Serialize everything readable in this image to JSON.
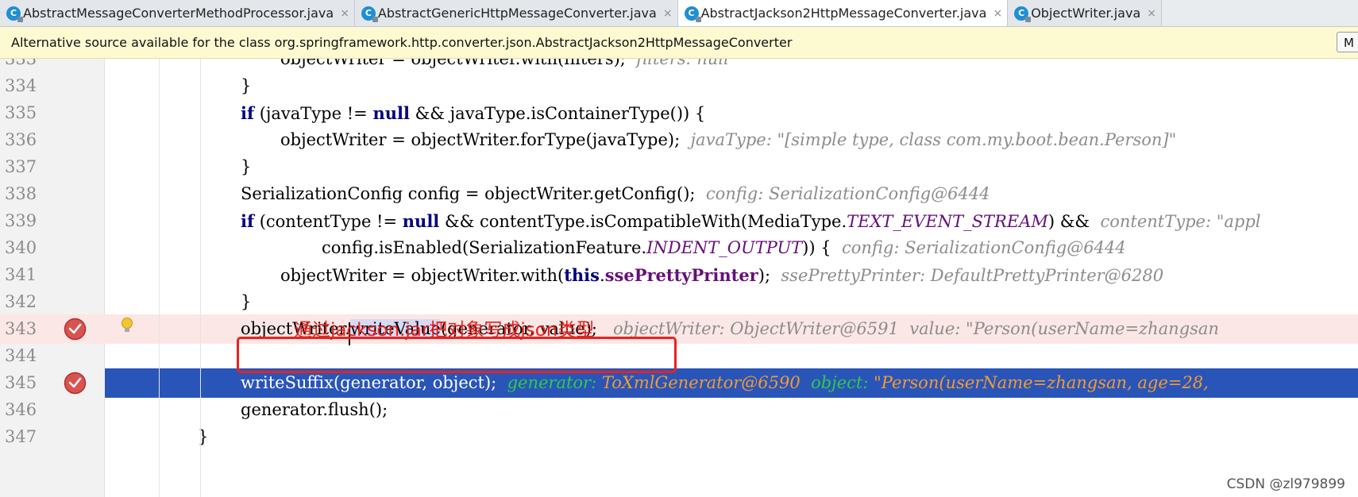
{
  "tabs": [
    {
      "label": "AbstractMessageConverterMethodProcessor.java",
      "active": false
    },
    {
      "label": "AbstractGenericHttpMessageConverter.java",
      "active": false
    },
    {
      "label": "AbstractJackson2HttpMessageConverter.java",
      "active": true
    },
    {
      "label": "ObjectWriter.java",
      "active": false
    }
  ],
  "tab_close_glyph": "×",
  "file_icon_letter": "C",
  "banner": {
    "text": "Alternative source available for the class org.springframework.http.converter.json.AbstractJackson2HttpMessageConverter",
    "button_label": "M"
  },
  "editor": {
    "lines": [
      {
        "num": "333",
        "code": "objectWriter = objectWriter.with(filters);",
        "hint": "filters: null"
      },
      {
        "num": "334",
        "code": "}"
      },
      {
        "num": "335",
        "kw": "if",
        "code": " (javaType != ",
        "kw2": "null",
        "code2": " && javaType.isContainerType()) {"
      },
      {
        "num": "336",
        "code": "objectWriter = objectWriter.forType(javaType);",
        "hint": "javaType: \"[simple type, class com.my.boot.bean.Person]\""
      },
      {
        "num": "337",
        "code": "}"
      },
      {
        "num": "338",
        "code": "SerializationConfig config = objectWriter.getConfig();",
        "hint": "config: SerializationConfig@6444"
      },
      {
        "num": "339",
        "kw": "if",
        "code": " (contentType != ",
        "kw2": "null",
        "code2": " && contentType.isCompatibleWith(MediaType.",
        "static": "TEXT_EVENT_STREAM",
        "code3": ") &&",
        "hint": "contentType: \"appl"
      },
      {
        "num": "340",
        "code": "config.isEnabled(SerializationFeature.",
        "static": "INDENT_OUTPUT",
        "code3": ")) {",
        "hint": "config: SerializationConfig@6444"
      },
      {
        "num": "341",
        "code": "objectWriter = objectWriter.with(",
        "kw": "this",
        "code2": ".",
        "field": "ssePrettyPrinter",
        "code3": ");",
        "hint": "ssePrettyPrinter: DefaultPrettyPrinter@6280"
      },
      {
        "num": "342",
        "code": "}"
      },
      {
        "num": "343",
        "code": "objectWriter.",
        "method": "writeValue",
        "code2": "(generator, value);",
        "hint": "objectWriter: ObjectWriter@6591  value: \"Person(userName=zhangsan"
      },
      {
        "num": "344",
        "code": ""
      },
      {
        "num": "345",
        "code": "writeSuffix(generator, object);",
        "hint_k1": "generator:",
        "hint_v1": "ToXmlGenerator@6590",
        "hint_k2": "object:",
        "hint_v2": "\"Person(userName=zhangsan, age=28, "
      },
      {
        "num": "346",
        "code": "generator.flush();"
      },
      {
        "num": "347",
        "code": "}"
      }
    ]
  },
  "annotation": "通过jackson.jar把对象写成json类型",
  "watermark": "CSDN @zl979899",
  "colors": {
    "breakpoint_line": "#fbe7e5",
    "exec_line": "#2955b8",
    "annotation_red": "#e8221f"
  }
}
